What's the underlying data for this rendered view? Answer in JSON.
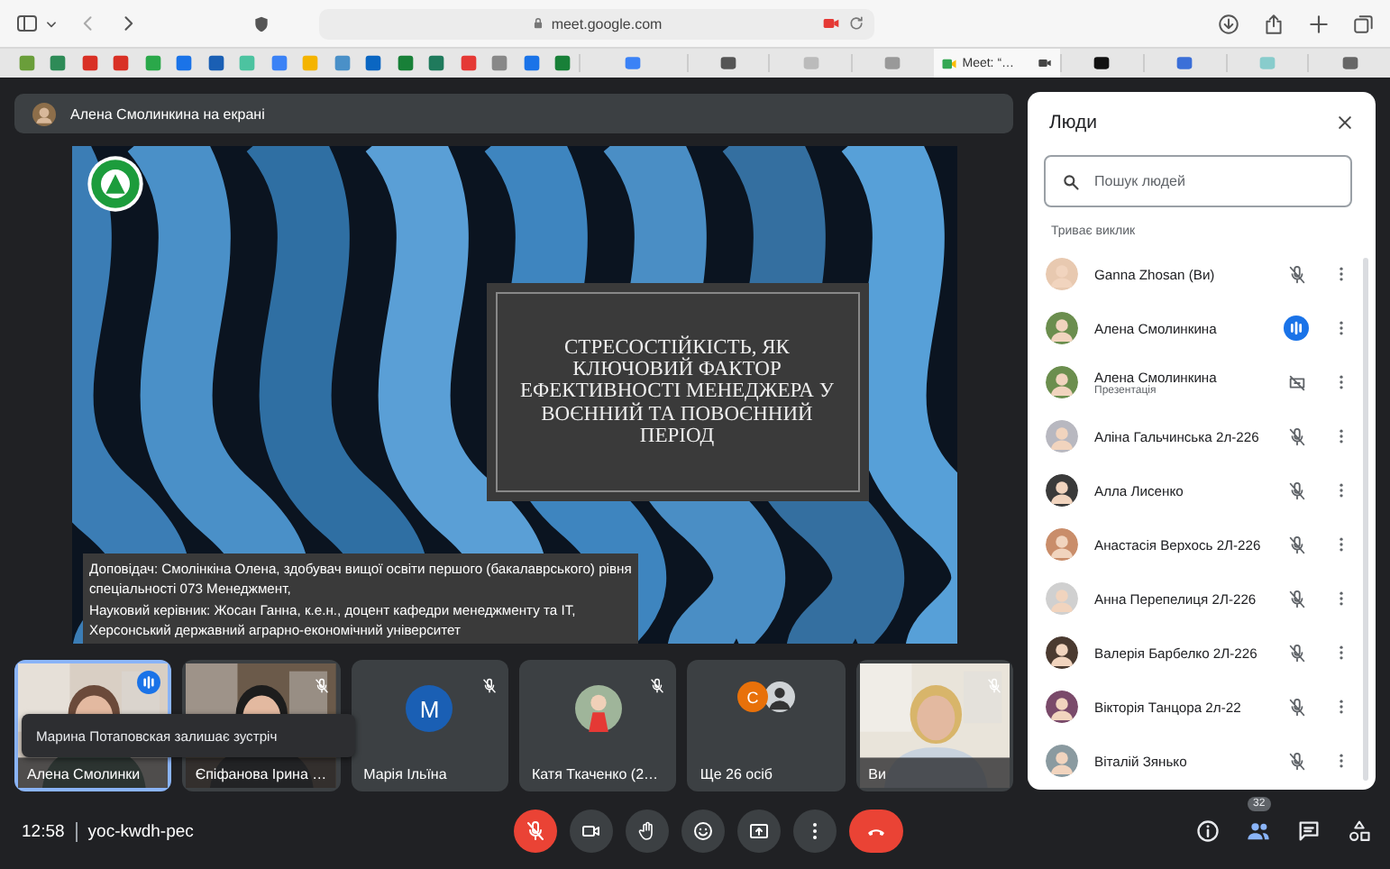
{
  "browser": {
    "address": "meet.google.com",
    "tab_label": "Meet: “…"
  },
  "presenter_banner": {
    "text": "Алена Смолинкина на екрані"
  },
  "slide": {
    "title": "СТРЕСОСТІЙКІСТЬ, ЯК КЛЮЧОВИЙ ФАКТОР ЕФЕКТИВНОСТІ МЕНЕДЖЕРА У ВОЄННИЙ ТА ПОВОЄННИЙ ПЕРІОД",
    "caption_lines": [
      "Доповідач: Смолінкіна Олена, здобувач вищої освіти першого (бакалаврського) рівня",
      "спеціальності 073 Менеджмент,",
      "Науковий керівник: Жосан Ганна, к.е.н., доцент кафедри менеджменту та IT,",
      "Херсонський державний аграрно-економічний університет"
    ]
  },
  "tiles": [
    {
      "kind": "video",
      "name": "Алена Смолинки",
      "speaking": true,
      "muted": false
    },
    {
      "kind": "video",
      "name": "Єпіфанова Ірина …",
      "speaking": false,
      "muted": true
    },
    {
      "kind": "initial",
      "initial": "M",
      "name": "Марія Ільїна",
      "speaking": false,
      "muted": true
    },
    {
      "name": "Катя Ткаченко (2…",
      "speaking": false,
      "muted": true
    },
    {
      "kind": "group",
      "initial": "С",
      "name": "Ще 26 осіб",
      "speaking": false,
      "muted": false
    },
    {
      "kind": "video",
      "name": "Ви",
      "speaking": false,
      "muted": true
    }
  ],
  "toast": "Марина Потаповская залишає зустріч",
  "meeting": {
    "time": "12:58",
    "code": "yoc-kwdh-pec"
  },
  "controls": [
    {
      "kind": "mic",
      "alert": true
    },
    {
      "kind": "camera",
      "alert": false
    },
    {
      "kind": "hand",
      "alert": false
    },
    {
      "kind": "emoji",
      "alert": false
    },
    {
      "kind": "present",
      "alert": false
    },
    {
      "kind": "more",
      "alert": false
    },
    {
      "kind": "end",
      "alert": true
    }
  ],
  "side_buttons": [
    {
      "kind": "info",
      "selected": false
    },
    {
      "kind": "people",
      "selected": true,
      "badge": "32"
    },
    {
      "kind": "chat",
      "selected": false
    },
    {
      "kind": "activities",
      "selected": false
    }
  ],
  "people_panel": {
    "title": "Люди",
    "search": {
      "placeholder": "Пошук людей"
    },
    "section": "Триває виклик",
    "people": [
      {
        "kind": "muted",
        "name": "Ganna Zhosan (Ви)"
      },
      {
        "kind": "speaking",
        "name": "Алена Смолинкина"
      },
      {
        "kind": "presentation",
        "name": "Алена Смолинкина",
        "subtitle": "Презентація"
      },
      {
        "kind": "muted",
        "name": "Аліна Гальчинська 2л-226"
      },
      {
        "kind": "muted",
        "name": "Алла Лисенко"
      },
      {
        "kind": "muted",
        "name": "Анастасія Верхось 2Л-226"
      },
      {
        "kind": "muted",
        "name": "Анна Перепелиця 2Л-226"
      },
      {
        "kind": "muted",
        "name": "Валерія Барбелко 2Л-226"
      },
      {
        "kind": "muted",
        "name": "Вікторія Танцора 2л-22"
      },
      {
        "kind": "muted",
        "name": "Віталій Зянько"
      }
    ]
  }
}
